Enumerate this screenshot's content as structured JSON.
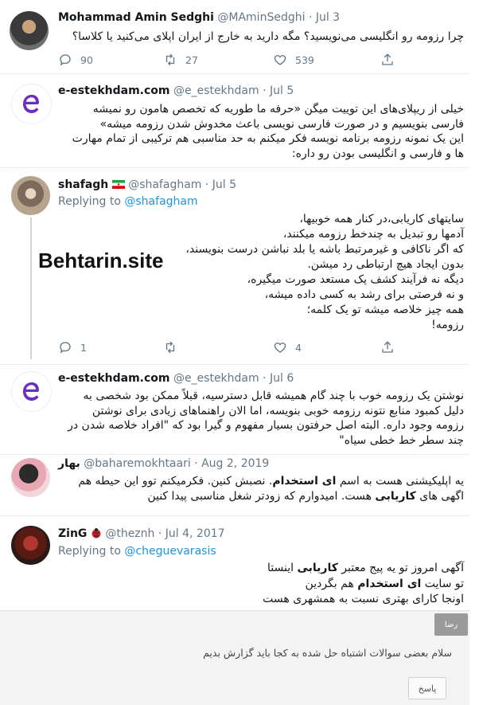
{
  "tweets": [
    {
      "name": "Mohammad Amin Sedghi",
      "handle": "@MAminSedghi",
      "date": "Jul 3",
      "lines": [
        "چرا رزومه رو انگلیسی می‌نویسید؟ مگه دارید به خارج از ایران اپلای می‌کنید یا کلاسا؟"
      ],
      "reply_count": "90",
      "retweet_count": "27",
      "like_count": "539"
    },
    {
      "name": "e-estekhdam.com",
      "handle": "@e_estekhdam",
      "date": "Jul 5",
      "lines": [
        "خیلی از ریپلای‌های این توییت میگن «حرفه ما طوریه که تخصص هامون رو نمیشه",
        "فارسی بنویسیم و در صورت فارسی نویسی باعث مخدوش شدن رزومه میشه»",
        "این یک نمونه رزومه برنامه نویسه فکر میکنم به حد مناسبی هم ترکیبی از تمام مهارت",
        "ها و فارسی و انگلیسی بودن رو داره:"
      ]
    },
    {
      "name": "shafagh",
      "handle": "@shafagham",
      "date": "Jul 5",
      "replying_label": "Replying to",
      "replying_to": "@shafagham",
      "lines": [
        "سایتهای کاریابی،در کنار همه خوبیها،",
        "آدمها رو تبدیل به چندخط رزومه میکنند،",
        "که اگر ناکافی و غیرمرتبط باشه یا بلد نباشن درست بنویسند،",
        "بدون ایجاد هیچ ارتباطی رد میشن.",
        "دیگه نه فرآیند کشف یک مستعد صورت میگیره،",
        "و نه فرصتی برای رشد به کسی داده میشه،",
        "همه چیز خلاصه میشه تو یک کلمه؛",
        "رزومه!"
      ],
      "reply_count": "1",
      "like_count": "4"
    },
    {
      "name": "e-estekhdam.com",
      "handle": "@e_estekhdam",
      "date": "Jul 6",
      "lines": [
        "نوشتن یک رزومه خوب با چند گام همیشه قابل دسترسیه، قبلاً ممکن بود شخصی به",
        "دلیل کمبود منابع نتونه رزومه خوبی بنویسه، اما الان راهنماهای زیادی برای نوشتن",
        "رزومه وجود داره. البته اصل حرفتون بسیار مفهوم و گیرا بود که \"افراد خلاصه شدن در",
        "چند سطر خط خطی سیاه\""
      ]
    },
    {
      "name": "بهار",
      "handle": "@baharemokhtaari",
      "date": "Aug 2, 2019",
      "line1_a": "یه اپلیکیشنی هست به اسم ",
      "line1_b": "ای استخدام",
      "line1_c": ". نصبش کنین. فکرمیکنم توو این حیطه هم",
      "line2_a": "اگهی های ",
      "line2_b": "کاریابی",
      "line2_c": " هست. امیدوارم که زودتر شغل مناسبی پیدا کنین"
    },
    {
      "name": "ZinG",
      "handle": "@theznh",
      "date": "Jul 4, 2017",
      "replying_label": "Replying to",
      "replying_to": "@cheguevarasis",
      "line1_a": "آگهی امروز تو یه پیج معتبر ",
      "line1_b": "کاریابی",
      "line1_c": " اینستا",
      "line2_a": "تو سایت ",
      "line2_b": "ای استخدام",
      "line2_c": " هم بگردین",
      "line3": "اونجا کارای بهتری نسبت به همشهری هست"
    }
  ],
  "sep": "·",
  "watermark": "Behtarin.site",
  "comment_box": {
    "user": "رضا",
    "text": "سلام بعضی سوالات اشتباه حل شده به کجا باید گزارش بدیم",
    "reply_button": "پاسخ"
  },
  "colors": {
    "accent": "#1b95e0",
    "muted": "#657786",
    "logo_purple": "#6b2fbf"
  }
}
